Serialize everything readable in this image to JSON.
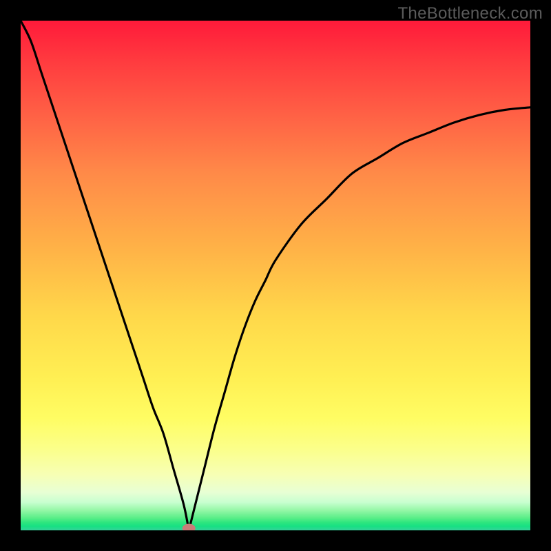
{
  "watermark": "TheBottleneck.com",
  "chart_data": {
    "type": "line",
    "title": "",
    "xlabel": "",
    "ylabel": "",
    "xlim": [
      0,
      100
    ],
    "ylim": [
      0,
      100
    ],
    "x": [
      0,
      2,
      4,
      6,
      8,
      10,
      12,
      14,
      16,
      18,
      20,
      22,
      24,
      26,
      28,
      30,
      32,
      33,
      34,
      36,
      38,
      40,
      42,
      44,
      46,
      48,
      50,
      55,
      60,
      65,
      70,
      75,
      80,
      85,
      90,
      95,
      100
    ],
    "values": [
      100,
      96,
      90,
      84,
      78,
      72,
      66,
      60,
      54,
      48,
      42,
      36,
      30,
      24,
      19,
      12,
      5,
      0,
      4,
      12,
      20,
      27,
      34,
      40,
      45,
      49,
      53,
      60,
      65,
      70,
      73,
      76,
      78,
      80,
      81.5,
      82.5,
      83
    ],
    "marker": {
      "x": 33,
      "y": 0,
      "color": "#c97d79"
    },
    "background": "red-yellow-green vertical gradient",
    "grid": false
  }
}
